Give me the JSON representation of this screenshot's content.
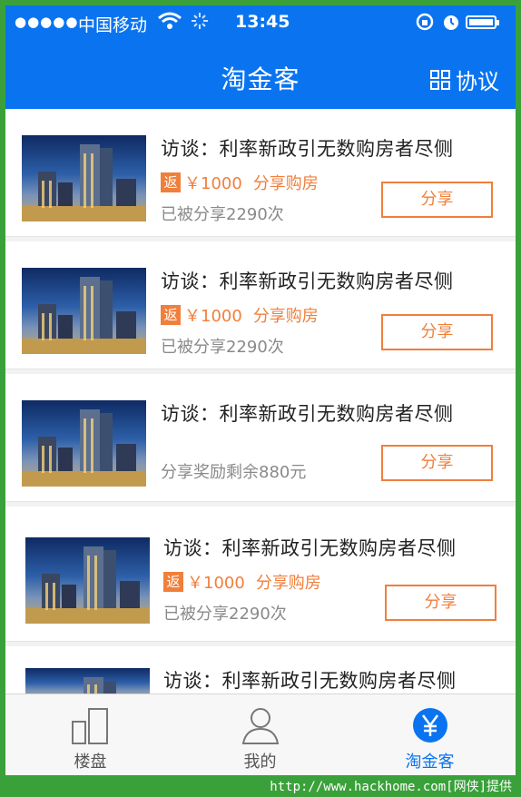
{
  "status_bar": {
    "signal": "●●●●●",
    "carrier": "中国移动",
    "time": "13:45"
  },
  "nav": {
    "title": "淘金客",
    "right_label": "协议",
    "right_icon": "grid-icon"
  },
  "items": [
    {
      "title": "访谈：利率新政引无数购房者尽侧",
      "badge": "返",
      "amount": "￥1000",
      "reward_text": "分享购房",
      "meta": "已被分享2290次",
      "button": "分享"
    },
    {
      "title": "访谈：利率新政引无数购房者尽侧",
      "badge": "返",
      "amount": "￥1000",
      "reward_text": "分享购房",
      "meta": "已被分享2290次",
      "button": "分享"
    },
    {
      "title": "访谈：利率新政引无数购房者尽侧",
      "meta": "分享奖励剩余880元",
      "button": "分享"
    },
    {
      "title": "访谈：利率新政引无数购房者尽侧",
      "badge": "返",
      "amount": "￥1000",
      "reward_text": "分享购房",
      "meta": "已被分享2290次",
      "button": "分享"
    },
    {
      "title": "访谈：利率新政引无数购房者尽侧"
    }
  ],
  "tabs": [
    {
      "label": "楼盘",
      "icon": "building-icon",
      "active": false
    },
    {
      "label": "我的",
      "icon": "user-icon",
      "active": false
    },
    {
      "label": "淘金客",
      "icon": "yen-icon",
      "active": true
    }
  ],
  "watermark": "http://www.hackhome.com[网侠]提供",
  "colors": {
    "brand_blue": "#0a74f0",
    "accent_orange": "#f07f3c",
    "frame_green": "#3aa13a"
  }
}
